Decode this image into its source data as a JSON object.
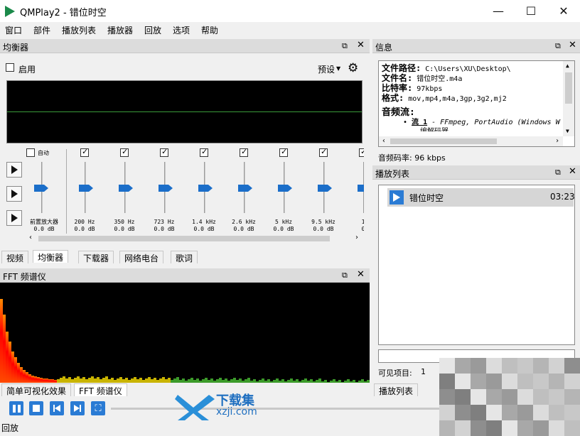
{
  "window": {
    "title": "QMPlay2 - 错位时空",
    "minimize": "—",
    "maximize": "☐",
    "close": "✕"
  },
  "menu": [
    "窗口",
    "部件",
    "播放列表",
    "播放器",
    "回放",
    "选项",
    "帮助"
  ],
  "equalizer": {
    "title": "均衡器",
    "enable_label": "启用",
    "preset_label": "预设",
    "auto_label": "自动",
    "preamp_label": "前置放大器",
    "preamp_value": "0.0 dB",
    "bands": [
      {
        "freq": "200 Hz",
        "gain": "0.0 dB"
      },
      {
        "freq": "350 Hz",
        "gain": "0.0 dB"
      },
      {
        "freq": "723 Hz",
        "gain": "0.0 dB"
      },
      {
        "freq": "1.4 kHz",
        "gain": "0.0 dB"
      },
      {
        "freq": "2.6 kHz",
        "gain": "0.0 dB"
      },
      {
        "freq": "5 kHz",
        "gain": "0.0 dB"
      },
      {
        "freq": "9.5 kHz",
        "gain": "0.0 dB"
      },
      {
        "freq": "1",
        "gain": "0"
      }
    ]
  },
  "left_tabs": [
    "视频",
    "均衡器",
    "下载器",
    "网络电台",
    "歌词"
  ],
  "fft": {
    "title": "FFT 频谱仪"
  },
  "bottom_tabs": [
    "简单可视化效果",
    "FFT 频谱仪"
  ],
  "info": {
    "title": "信息",
    "path_label": "文件路径:",
    "path_value": "C:\\Users\\XU\\Desktop\\",
    "name_label": "文件名:",
    "name_value": "错位时空.m4a",
    "bitrate_label": "比特率:",
    "bitrate_value": "97kbps",
    "format_label": "格式:",
    "format_value": "mov,mp4,m4a,3gp,3g2,mj2",
    "audio_stream_label": "音频流:",
    "stream_label": "流 1",
    "stream_value": "- FFmpeg, PortAudio (Windows W",
    "stream_extra": "编解码器",
    "audio_bitrate": "音频码率: 96 kbps"
  },
  "playlist": {
    "title": "播放列表",
    "items": [
      {
        "name": "错位时空",
        "duration": "03:23"
      }
    ],
    "visible_label": "可见项目:",
    "visible_count": "1",
    "tab_label": "播放列表"
  },
  "status": {
    "text": "回放"
  },
  "watermark": {
    "text": "下载集",
    "url": "xzji.com"
  }
}
